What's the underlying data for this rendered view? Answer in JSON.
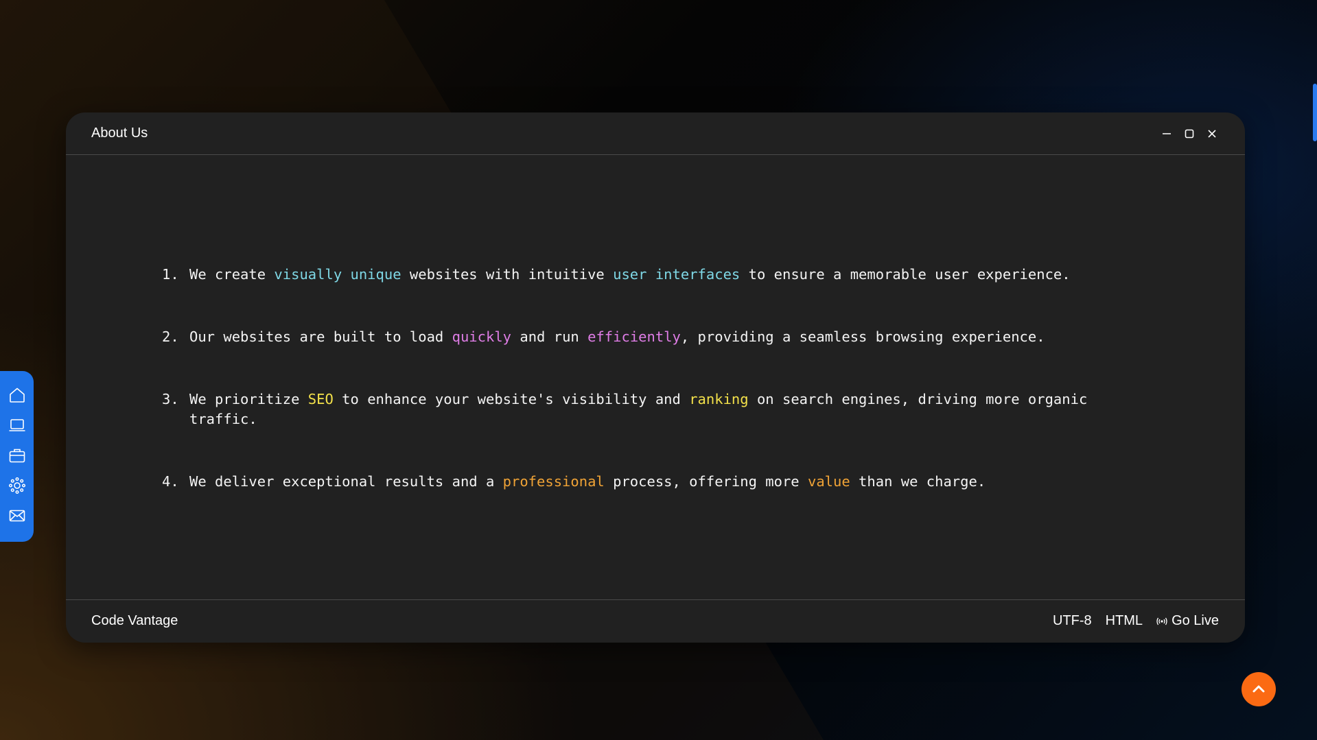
{
  "window": {
    "title": "About Us",
    "controls": [
      "minimize-icon",
      "maximize-icon",
      "close-icon"
    ]
  },
  "items": [
    {
      "number": "1.",
      "parts": [
        {
          "text": "We create ",
          "color": ""
        },
        {
          "text": "visually unique",
          "color": "#7fd8e6"
        },
        {
          "text": " websites with intuitive ",
          "color": ""
        },
        {
          "text": "user interfaces",
          "color": "#7fd8e6"
        },
        {
          "text": " to ensure a memorable user experience.",
          "color": ""
        }
      ]
    },
    {
      "number": "2.",
      "parts": [
        {
          "text": "Our websites are built to load ",
          "color": ""
        },
        {
          "text": "quickly",
          "color": "#df7de6"
        },
        {
          "text": " and run ",
          "color": ""
        },
        {
          "text": "efficiently",
          "color": "#df7de6"
        },
        {
          "text": ", providing a seamless browsing experience.",
          "color": ""
        }
      ]
    },
    {
      "number": "3.",
      "parts": [
        {
          "text": "We prioritize ",
          "color": ""
        },
        {
          "text": "SEO",
          "color": "#f2e04a"
        },
        {
          "text": " to enhance your website's visibility and ",
          "color": ""
        },
        {
          "text": "ranking",
          "color": "#f2e04a"
        },
        {
          "text": " on search engines, driving more organic traffic.",
          "color": ""
        }
      ]
    },
    {
      "number": "4.",
      "parts": [
        {
          "text": "We deliver exceptional results and a ",
          "color": ""
        },
        {
          "text": "professional",
          "color": "#f0a336"
        },
        {
          "text": " process, offering more ",
          "color": ""
        },
        {
          "text": "value",
          "color": "#f0a336"
        },
        {
          "text": " than we charge.",
          "color": ""
        }
      ]
    }
  ],
  "statusbar": {
    "brand": "Code Vantage",
    "encoding": "UTF-8",
    "language": "HTML",
    "go_live": "Go Live",
    "go_live_icon": "broadcast-icon"
  },
  "dock": {
    "items": [
      "home-icon",
      "laptop-icon",
      "briefcase-icon",
      "settings-icon",
      "mail-icon"
    ],
    "color": "#1e73e8"
  },
  "scroll_top": {
    "icon": "chevron-up-icon",
    "color": "#fb6a13"
  }
}
